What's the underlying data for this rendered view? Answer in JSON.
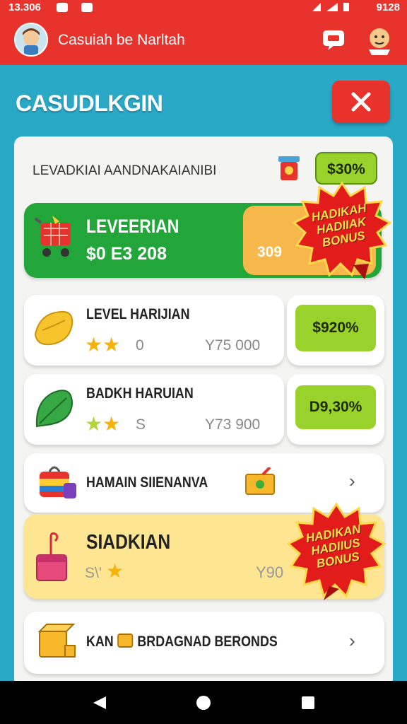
{
  "status_bar": {
    "time": "13.306",
    "clock": "9128"
  },
  "app_bar": {
    "title": "Casuiah be Narltah"
  },
  "header": {
    "title": "CASUDLKGIN"
  },
  "panel": {
    "header_label": "LEVADKIAI AANDNAKAIANIBI",
    "header_badge": "$30%"
  },
  "featured": {
    "title": "LEVEERIAN",
    "amount": "$0 E3 208",
    "value": "309",
    "burst": [
      "HADIKAH",
      "HADIIAK",
      "BONUS"
    ]
  },
  "items": [
    {
      "title": "LEVEL HARIJIAN",
      "count": "0",
      "amount": "Y75 000",
      "badge": "$920%"
    },
    {
      "title": "BADKH HARUIAN",
      "count": "S",
      "amount": "Y73 900",
      "badge": "D9,30%"
    }
  ],
  "links": [
    {
      "title": "HAMAIN SIIENANVA"
    },
    {
      "title": "KAN",
      "title_rest": "BRDAGNAD BERONDS"
    }
  ],
  "bonus_card": {
    "title": "SIADKIAN",
    "count": "S\\'",
    "amount": "Y90",
    "burst": [
      "HADIKAN",
      "HADIIUS",
      "BONUS"
    ]
  },
  "colors": {
    "accent": "#e8322c",
    "background": "#2aa9c6",
    "green": "#22a63a",
    "badge": "#9ad22c",
    "bonus_bg": "#fde591"
  },
  "icons": [
    "chat-icon",
    "close-icon",
    "cart-icon",
    "cheese-icon",
    "leaf-icon",
    "backpack-icon",
    "gift-icon",
    "box-icon",
    "star-icon",
    "chevron-right-icon"
  ]
}
